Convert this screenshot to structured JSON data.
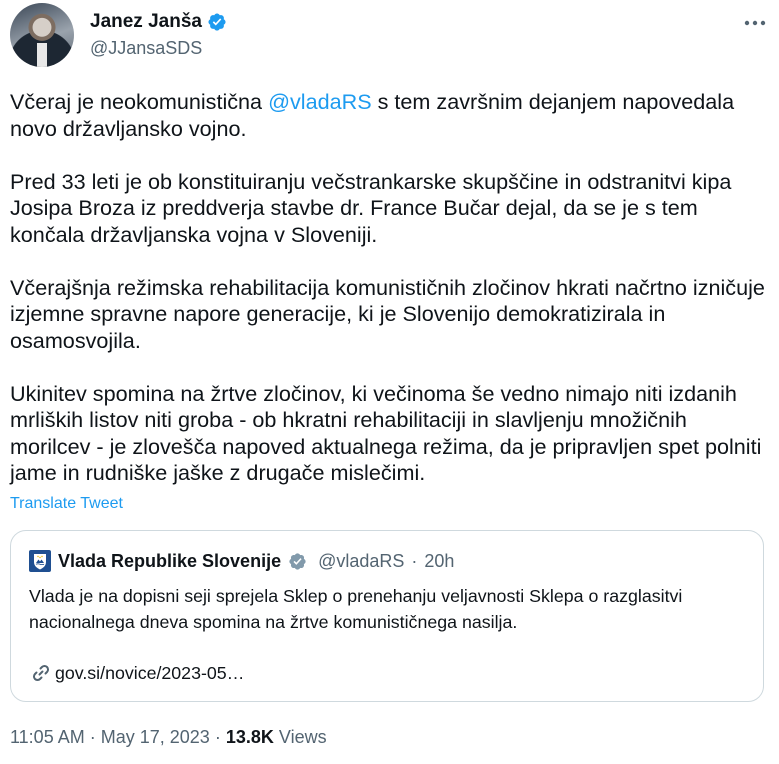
{
  "author": {
    "name": "Janez Janša",
    "handle": "@JJansaSDS",
    "verified_icon": "verified-badge-icon"
  },
  "tweet": {
    "p1_before": "Včeraj je neokomunistična ",
    "p1_mention": "@vladaRS",
    "p1_after": " s tem završnim dejanjem napovedala novo državljansko vojno.",
    "p2": "Pred 33 leti je ob konstituiranju večstrankarske skupščine in odstranitvi kipa Josipa Broza iz preddverja stavbe dr. France Bučar dejal, da se je s tem končala državljanska vojna v Sloveniji.",
    "p3": "Včerajšnja režimska rehabilitacija komunističnih zločinov hkrati načrtno izničuje izjemne spravne napore generacije, ki je Slovenijo demokratizirala in osamosvojila.",
    "p4": "Ukinitev spomina na žrtve zločinov, ki večinoma še vedno nimajo niti izdanih mrliških listov niti groba - ob hkratni rehabilitaciji in slavljenju množičnih morilcev -  je zlovešča napoved aktualnega režima, da je pripravljen spet polniti jame in rudniške jaške z drugače mislečimi.",
    "translate_label": "Translate Tweet"
  },
  "quoted": {
    "name": "Vlada Republike Slovenije",
    "handle": "@vladaRS",
    "time": "20h",
    "text": "Vlada je na dopisni seji sprejela Sklep o prenehanju veljavnosti Sklepa o razglasitvi nacionalnega dneva spomina na žrtve komunističnega nasilja.",
    "link": "gov.si/novice/2023-05…"
  },
  "meta": {
    "time": "11:05 AM",
    "separator": "·",
    "date": "May 17, 2023",
    "views_count": "13.8K",
    "views_label": "Views"
  },
  "colors": {
    "accent": "#1d9bf0",
    "text": "#0f1419",
    "secondary": "#536471",
    "border": "#cfd9de"
  }
}
